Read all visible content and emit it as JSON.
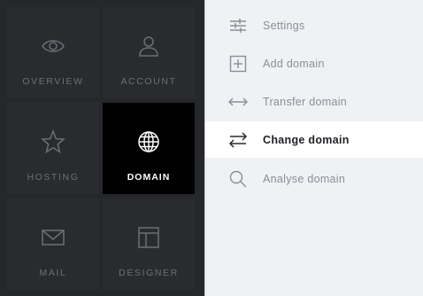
{
  "nav": {
    "tiles": [
      {
        "label": "OVERVIEW",
        "icon": "eye-icon"
      },
      {
        "label": "ACCOUNT",
        "icon": "user-icon"
      },
      {
        "label": "HOSTING",
        "icon": "star-icon"
      },
      {
        "label": "DOMAIN",
        "icon": "globe-icon",
        "active": true
      },
      {
        "label": "MAIL",
        "icon": "envelope-icon"
      },
      {
        "label": "DESIGNER",
        "icon": "layout-icon"
      }
    ]
  },
  "menu": {
    "items": [
      {
        "label": "Settings",
        "icon": "sliders-icon"
      },
      {
        "label": "Add domain",
        "icon": "plus-square-icon"
      },
      {
        "label": "Transfer domain",
        "icon": "double-arrow-icon"
      },
      {
        "label": "Change domain",
        "icon": "swap-icon",
        "active": true
      },
      {
        "label": "Analyse domain",
        "icon": "search-icon"
      }
    ]
  },
  "colors": {
    "panel_bg": "#26272b",
    "tile_bg": "#2a2b2f",
    "active_tile_bg": "#000000",
    "menu_bg": "#f0f1f4",
    "active_menu_bg": "#ffffff"
  }
}
